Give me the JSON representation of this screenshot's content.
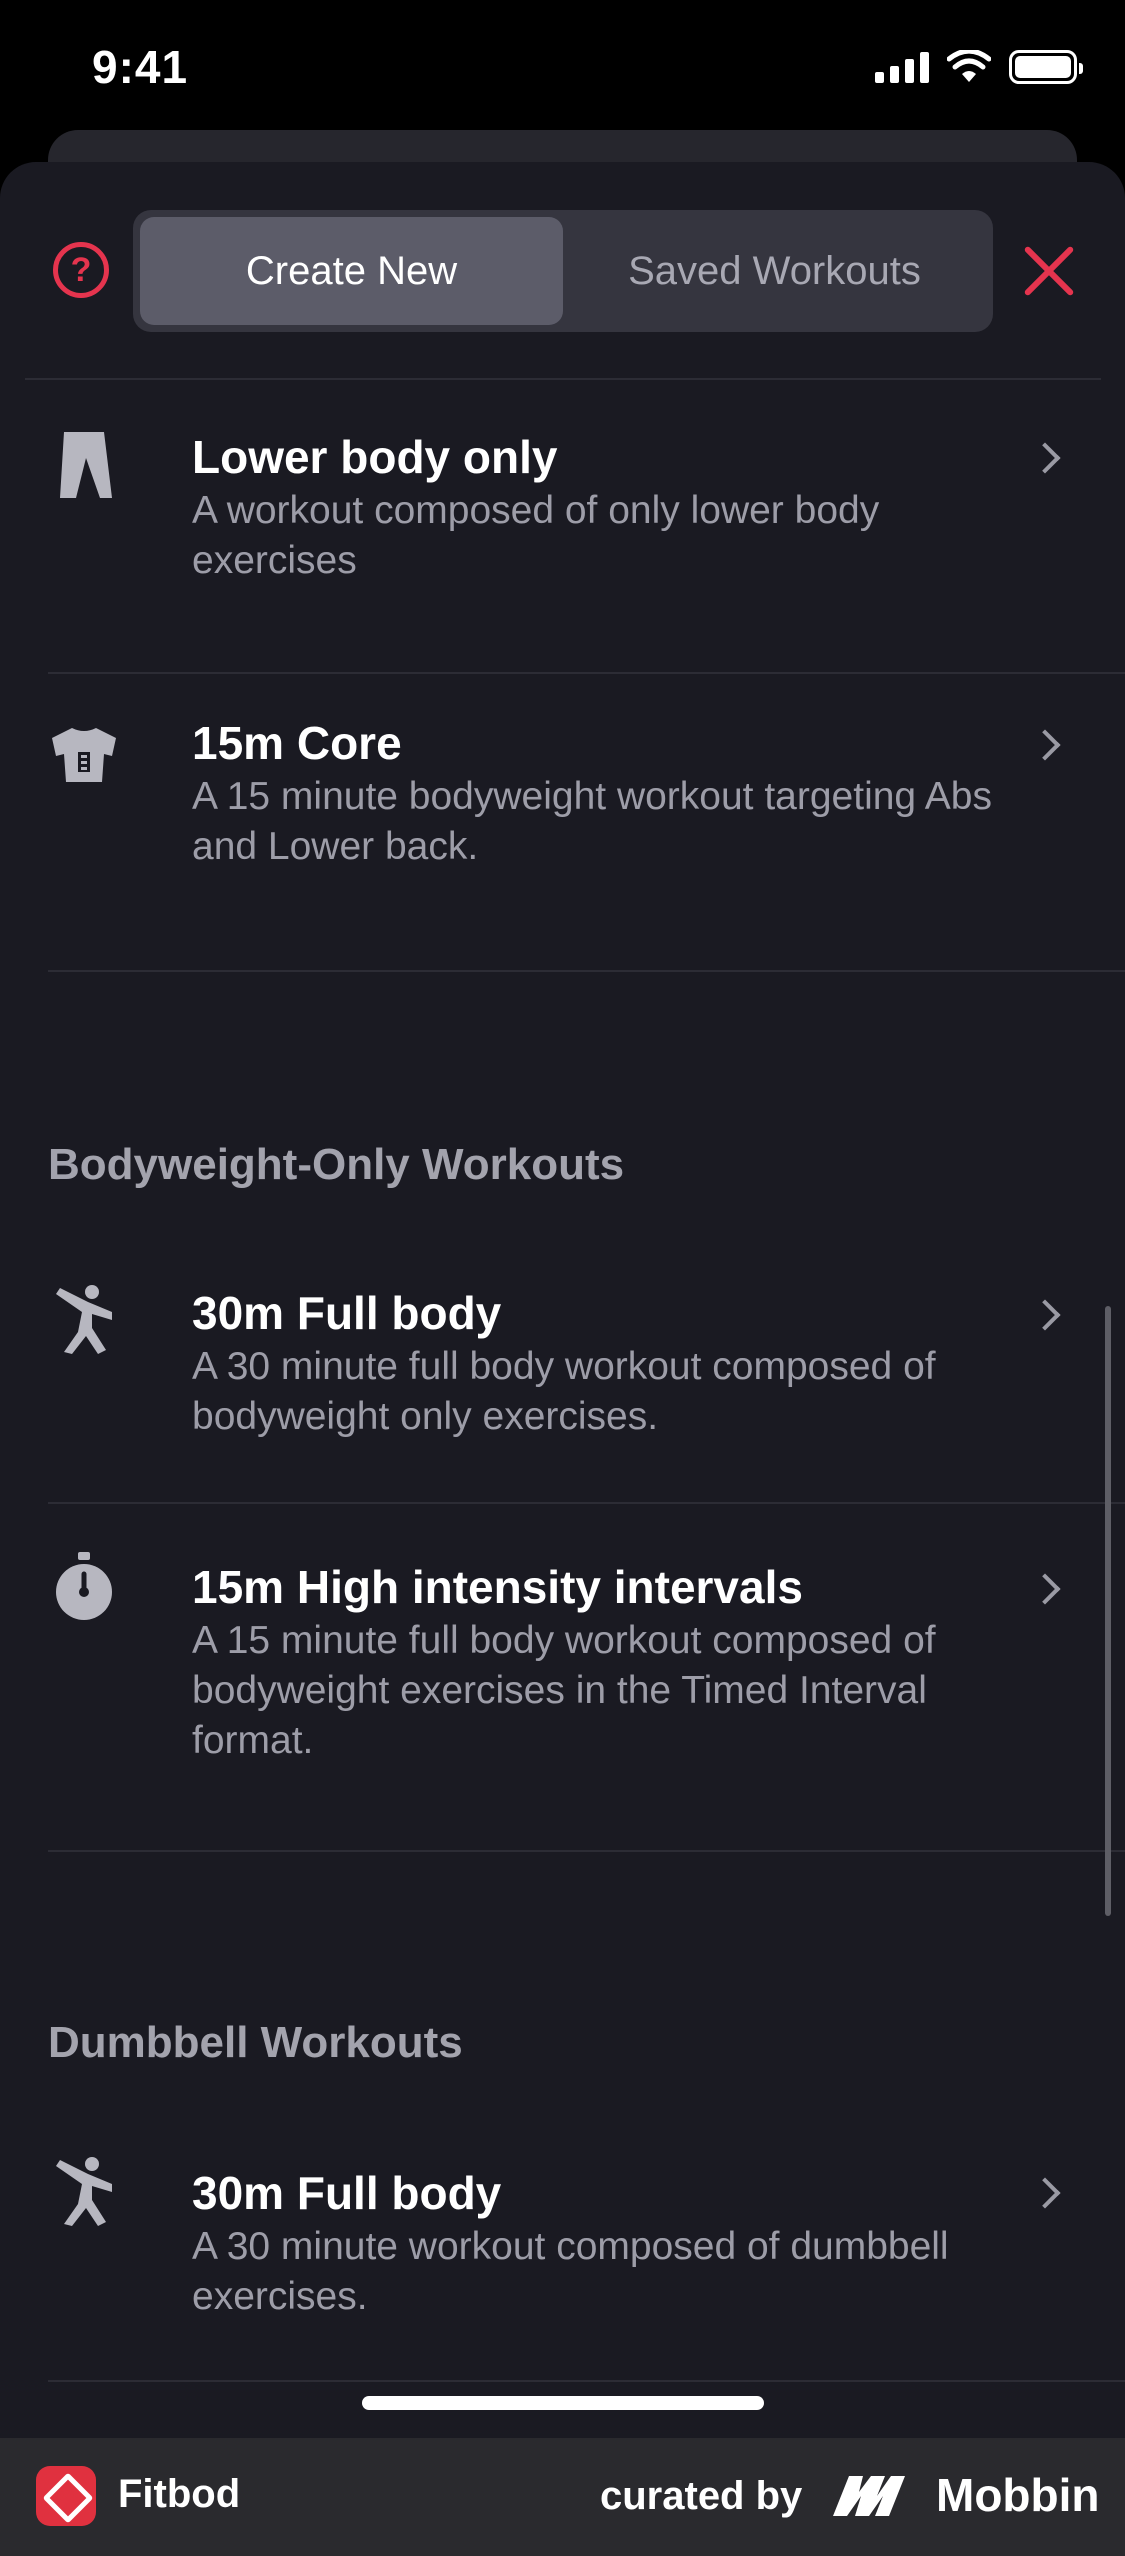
{
  "status_bar": {
    "time": "9:41"
  },
  "header": {
    "help_icon": "question-circle-icon",
    "tabs": [
      {
        "label": "Create New",
        "active": true
      },
      {
        "label": "Saved Workouts",
        "active": false
      }
    ],
    "close_icon": "close-x-icon"
  },
  "sections": [
    {
      "title": "",
      "items": [
        {
          "icon": "legs-icon",
          "title": "Lower body only",
          "description": "A workout composed of only lower body exercises"
        },
        {
          "icon": "torso-icon",
          "title": "15m Core",
          "description": "A 15 minute bodyweight workout targeting Abs and Lower back."
        }
      ]
    },
    {
      "title": "Bodyweight-Only Workouts",
      "items": [
        {
          "icon": "person-exercise-icon",
          "title": "30m Full body",
          "description": "A 30 minute full body workout composed of bodyweight only exercises."
        },
        {
          "icon": "stopwatch-icon",
          "title": "15m High intensity intervals",
          "description": "A 15 minute full body workout composed of bodyweight exercises in the Timed Interval format."
        }
      ]
    },
    {
      "title": "Dumbbell Workouts",
      "items": [
        {
          "icon": "person-exercise-icon",
          "title": "30m Full body",
          "description": "A 30 minute workout composed of dumbbell exercises."
        }
      ]
    }
  ],
  "footer": {
    "app_name": "Fitbod",
    "curated_by": "curated by",
    "brand": "Mobbin"
  },
  "colors": {
    "accent": "#e5344e",
    "sheet_bg": "#1a1a22",
    "segment_bg": "#35353f",
    "segment_active": "#5c5c69",
    "text_secondary": "#9d9da8"
  }
}
